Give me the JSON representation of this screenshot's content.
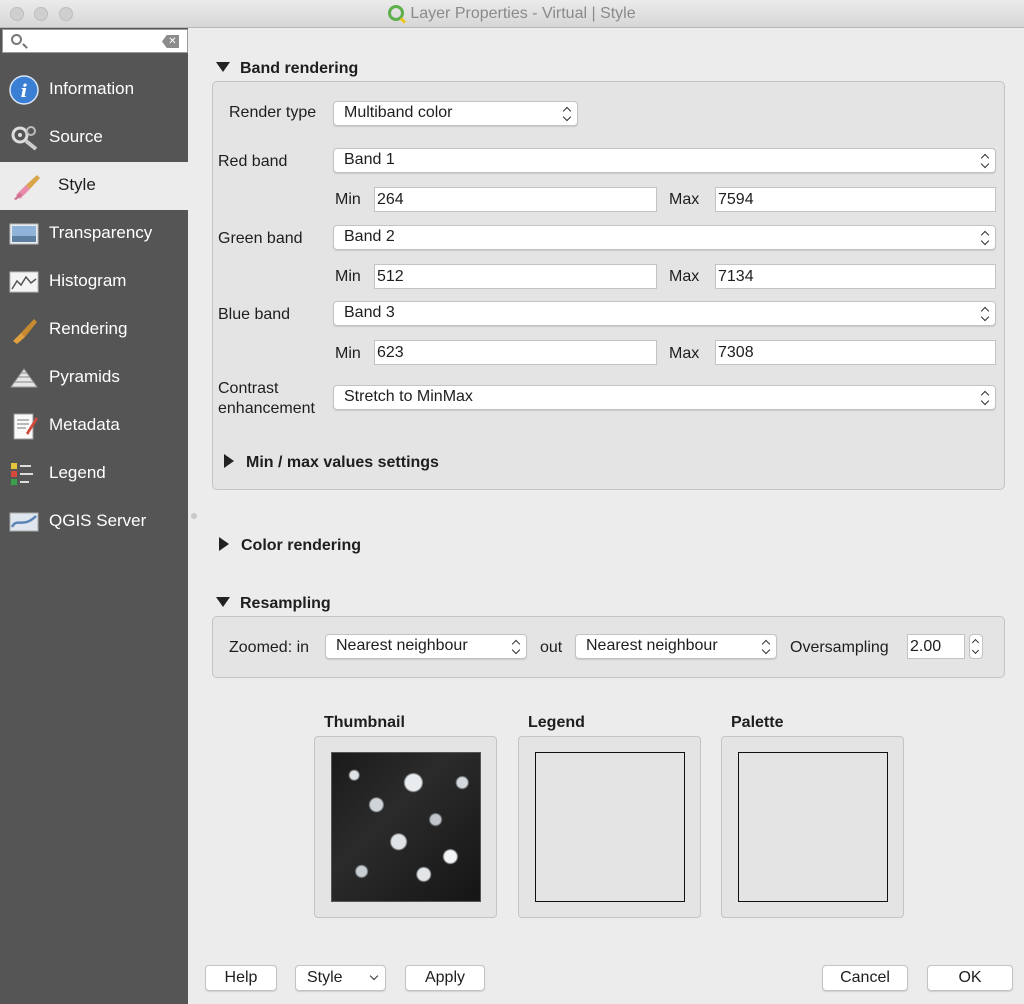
{
  "window": {
    "title": "Layer Properties - Virtual | Style"
  },
  "sidebar": {
    "search_placeholder": "",
    "items": [
      {
        "label": "Information",
        "icon": "info-icon"
      },
      {
        "label": "Source",
        "icon": "source-icon"
      },
      {
        "label": "Style",
        "icon": "style-brush-icon",
        "selected": true
      },
      {
        "label": "Transparency",
        "icon": "transparency-icon"
      },
      {
        "label": "Histogram",
        "icon": "histogram-icon"
      },
      {
        "label": "Rendering",
        "icon": "rendering-brush-icon"
      },
      {
        "label": "Pyramids",
        "icon": "pyramids-icon"
      },
      {
        "label": "Metadata",
        "icon": "metadata-icon"
      },
      {
        "label": "Legend",
        "icon": "legend-icon"
      },
      {
        "label": "QGIS Server",
        "icon": "qgis-server-icon"
      }
    ]
  },
  "band_rendering": {
    "header": "Band rendering",
    "render_type_label": "Render type",
    "render_type_value": "Multiband color",
    "red": {
      "label": "Red band",
      "band": "Band 1",
      "min_label": "Min",
      "min": "264",
      "max_label": "Max",
      "max": "7594"
    },
    "green": {
      "label": "Green band",
      "band": "Band 2",
      "min_label": "Min",
      "min": "512",
      "max_label": "Max",
      "max": "7134"
    },
    "blue": {
      "label": "Blue band",
      "band": "Band 3",
      "min_label": "Min",
      "min": "623",
      "max_label": "Max",
      "max": "7308"
    },
    "contrast_label_1": "Contrast",
    "contrast_label_2": "enhancement",
    "contrast_value": "Stretch to MinMax",
    "minmax_header": "Min / max values settings"
  },
  "color_rendering": {
    "header": "Color rendering"
  },
  "resampling": {
    "header": "Resampling",
    "zoomed_in_label": "Zoomed: in",
    "zoomed_in_value": "Nearest neighbour",
    "out_label": "out",
    "out_value": "Nearest neighbour",
    "oversampling_label": "Oversampling",
    "oversampling_value": "2.00"
  },
  "previews": {
    "thumbnail": "Thumbnail",
    "legend": "Legend",
    "palette": "Palette"
  },
  "buttons": {
    "help": "Help",
    "style": "Style",
    "apply": "Apply",
    "cancel": "Cancel",
    "ok": "OK"
  }
}
